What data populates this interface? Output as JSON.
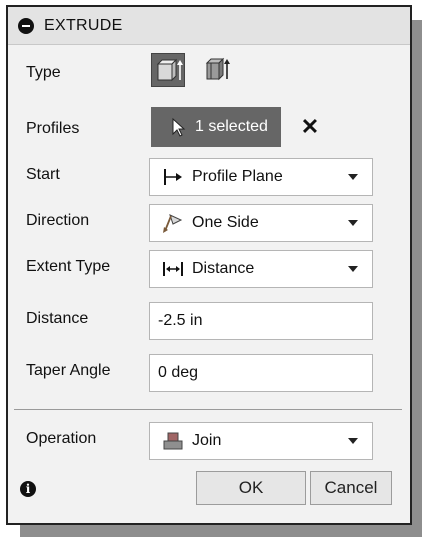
{
  "dialog": {
    "title": "EXTRUDE",
    "type": {
      "label": "Type"
    },
    "profiles": {
      "label": "Profiles",
      "selection": "1 selected"
    },
    "start": {
      "label": "Start",
      "value": "Profile Plane"
    },
    "direction": {
      "label": "Direction",
      "value": "One Side"
    },
    "extent_type": {
      "label": "Extent Type",
      "value": "Distance"
    },
    "distance": {
      "label": "Distance",
      "value": "-2.5 in"
    },
    "taper_angle": {
      "label": "Taper Angle",
      "value": "0 deg"
    },
    "operation": {
      "label": "Operation",
      "value": "Join"
    },
    "buttons": {
      "ok": "OK",
      "cancel": "Cancel"
    }
  }
}
